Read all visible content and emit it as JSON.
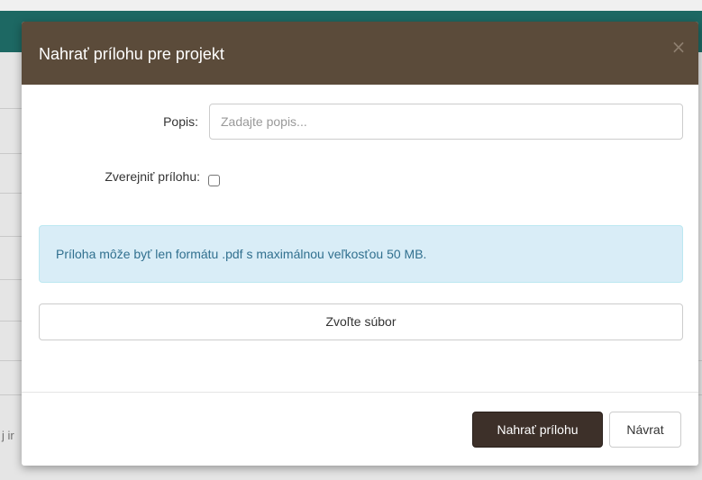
{
  "background": {
    "partial_text": "j ir"
  },
  "modal": {
    "title": "Nahrať prílohu pre projekt",
    "close_label": "×",
    "fields": {
      "popis_label": "Popis:",
      "popis_placeholder": "Zadajte popis...",
      "popis_value": "",
      "zverejnit_label": "Zverejniť prílohu:",
      "zverejnit_checked": false
    },
    "info_alert": "Príloha môže byť len formátu .pdf s maximálnou veľkosťou 50 MB.",
    "file_button": "Zvoľte súbor",
    "footer": {
      "upload_button": "Nahrať prílohu",
      "back_button": "Návrat"
    }
  },
  "colors": {
    "header_bg": "#5b4b3a",
    "primary_button_bg": "#3d3029",
    "alert_bg": "#d9edf7",
    "alert_text": "#31708f",
    "topbar_bg": "#1f6f6a"
  }
}
